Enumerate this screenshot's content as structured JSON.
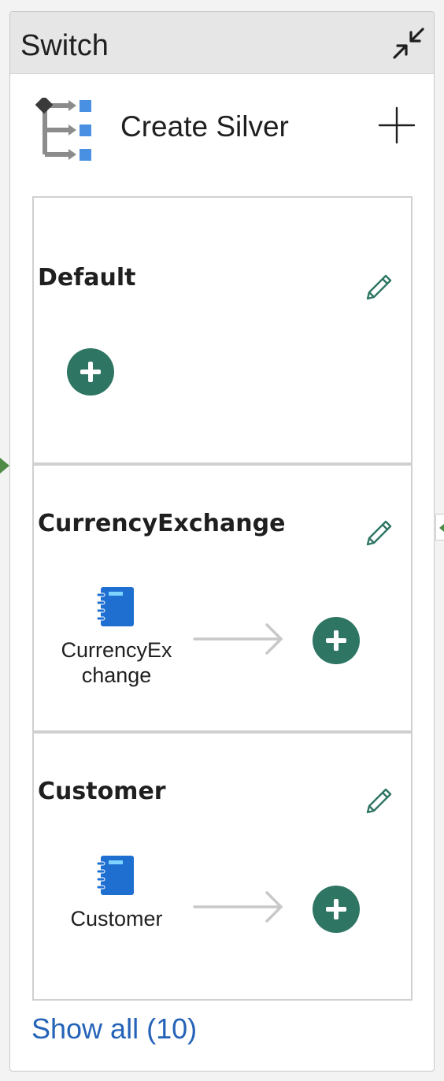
{
  "switch": {
    "title": "Switch",
    "activity_name": "Create Silver"
  },
  "cases": [
    {
      "label": "Default",
      "activities": []
    },
    {
      "label": "CurrencyExchange",
      "activities": [
        {
          "label": "CurrencyExchange",
          "type": "notebook-icon"
        }
      ]
    },
    {
      "label": "Customer",
      "activities": [
        {
          "label": "Customer",
          "type": "notebook-icon"
        }
      ]
    }
  ],
  "show_all": "Show all (10)",
  "colors": {
    "accent_green": "#2e7563",
    "link_blue": "#2563b8",
    "notebook_blue": "#1f6fd1",
    "connector_green": "#4f8a47"
  }
}
